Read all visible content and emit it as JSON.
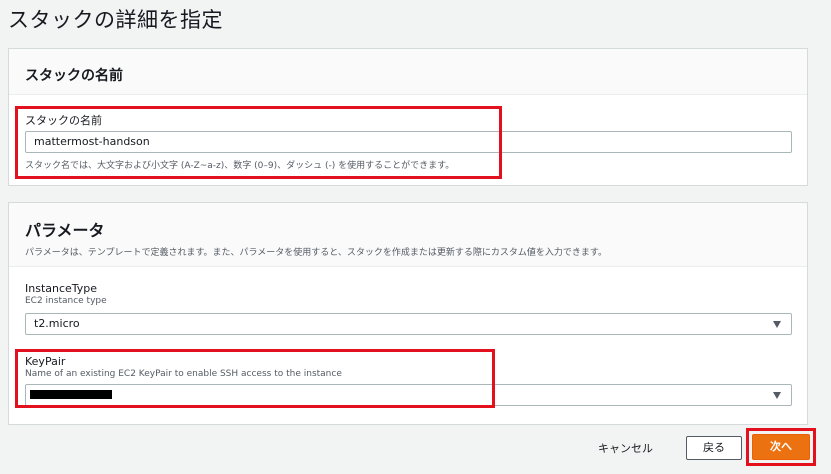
{
  "page": {
    "title": "スタックの詳細を指定"
  },
  "stack_name_panel": {
    "title": "スタックの名前",
    "field_label": "スタックの名前",
    "value": "mattermost-handson",
    "hint": "スタック名では、大文字および小文字 (A-Z~a-z)、数字 (0–9)、ダッシュ (-) を使用することができます。"
  },
  "parameters_panel": {
    "title": "パラメータ",
    "description": "パラメータは、テンプレートで定義されます。また、パラメータを使用すると、スタックを作成または更新する際にカスタム値を入力できます。",
    "instance_type": {
      "label": "InstanceType",
      "description": "EC2 instance type",
      "selected": "t2.micro"
    },
    "key_pair": {
      "label": "KeyPair",
      "description": "Name of an existing EC2 KeyPair to enable SSH access to the instance",
      "selected": ""
    }
  },
  "footer": {
    "cancel_label": "キャンセル",
    "back_label": "戻る",
    "next_label": "次へ"
  },
  "colors": {
    "highlight": "#e3101e",
    "primary_button": "#ec7211",
    "background": "#f2f3f3"
  }
}
